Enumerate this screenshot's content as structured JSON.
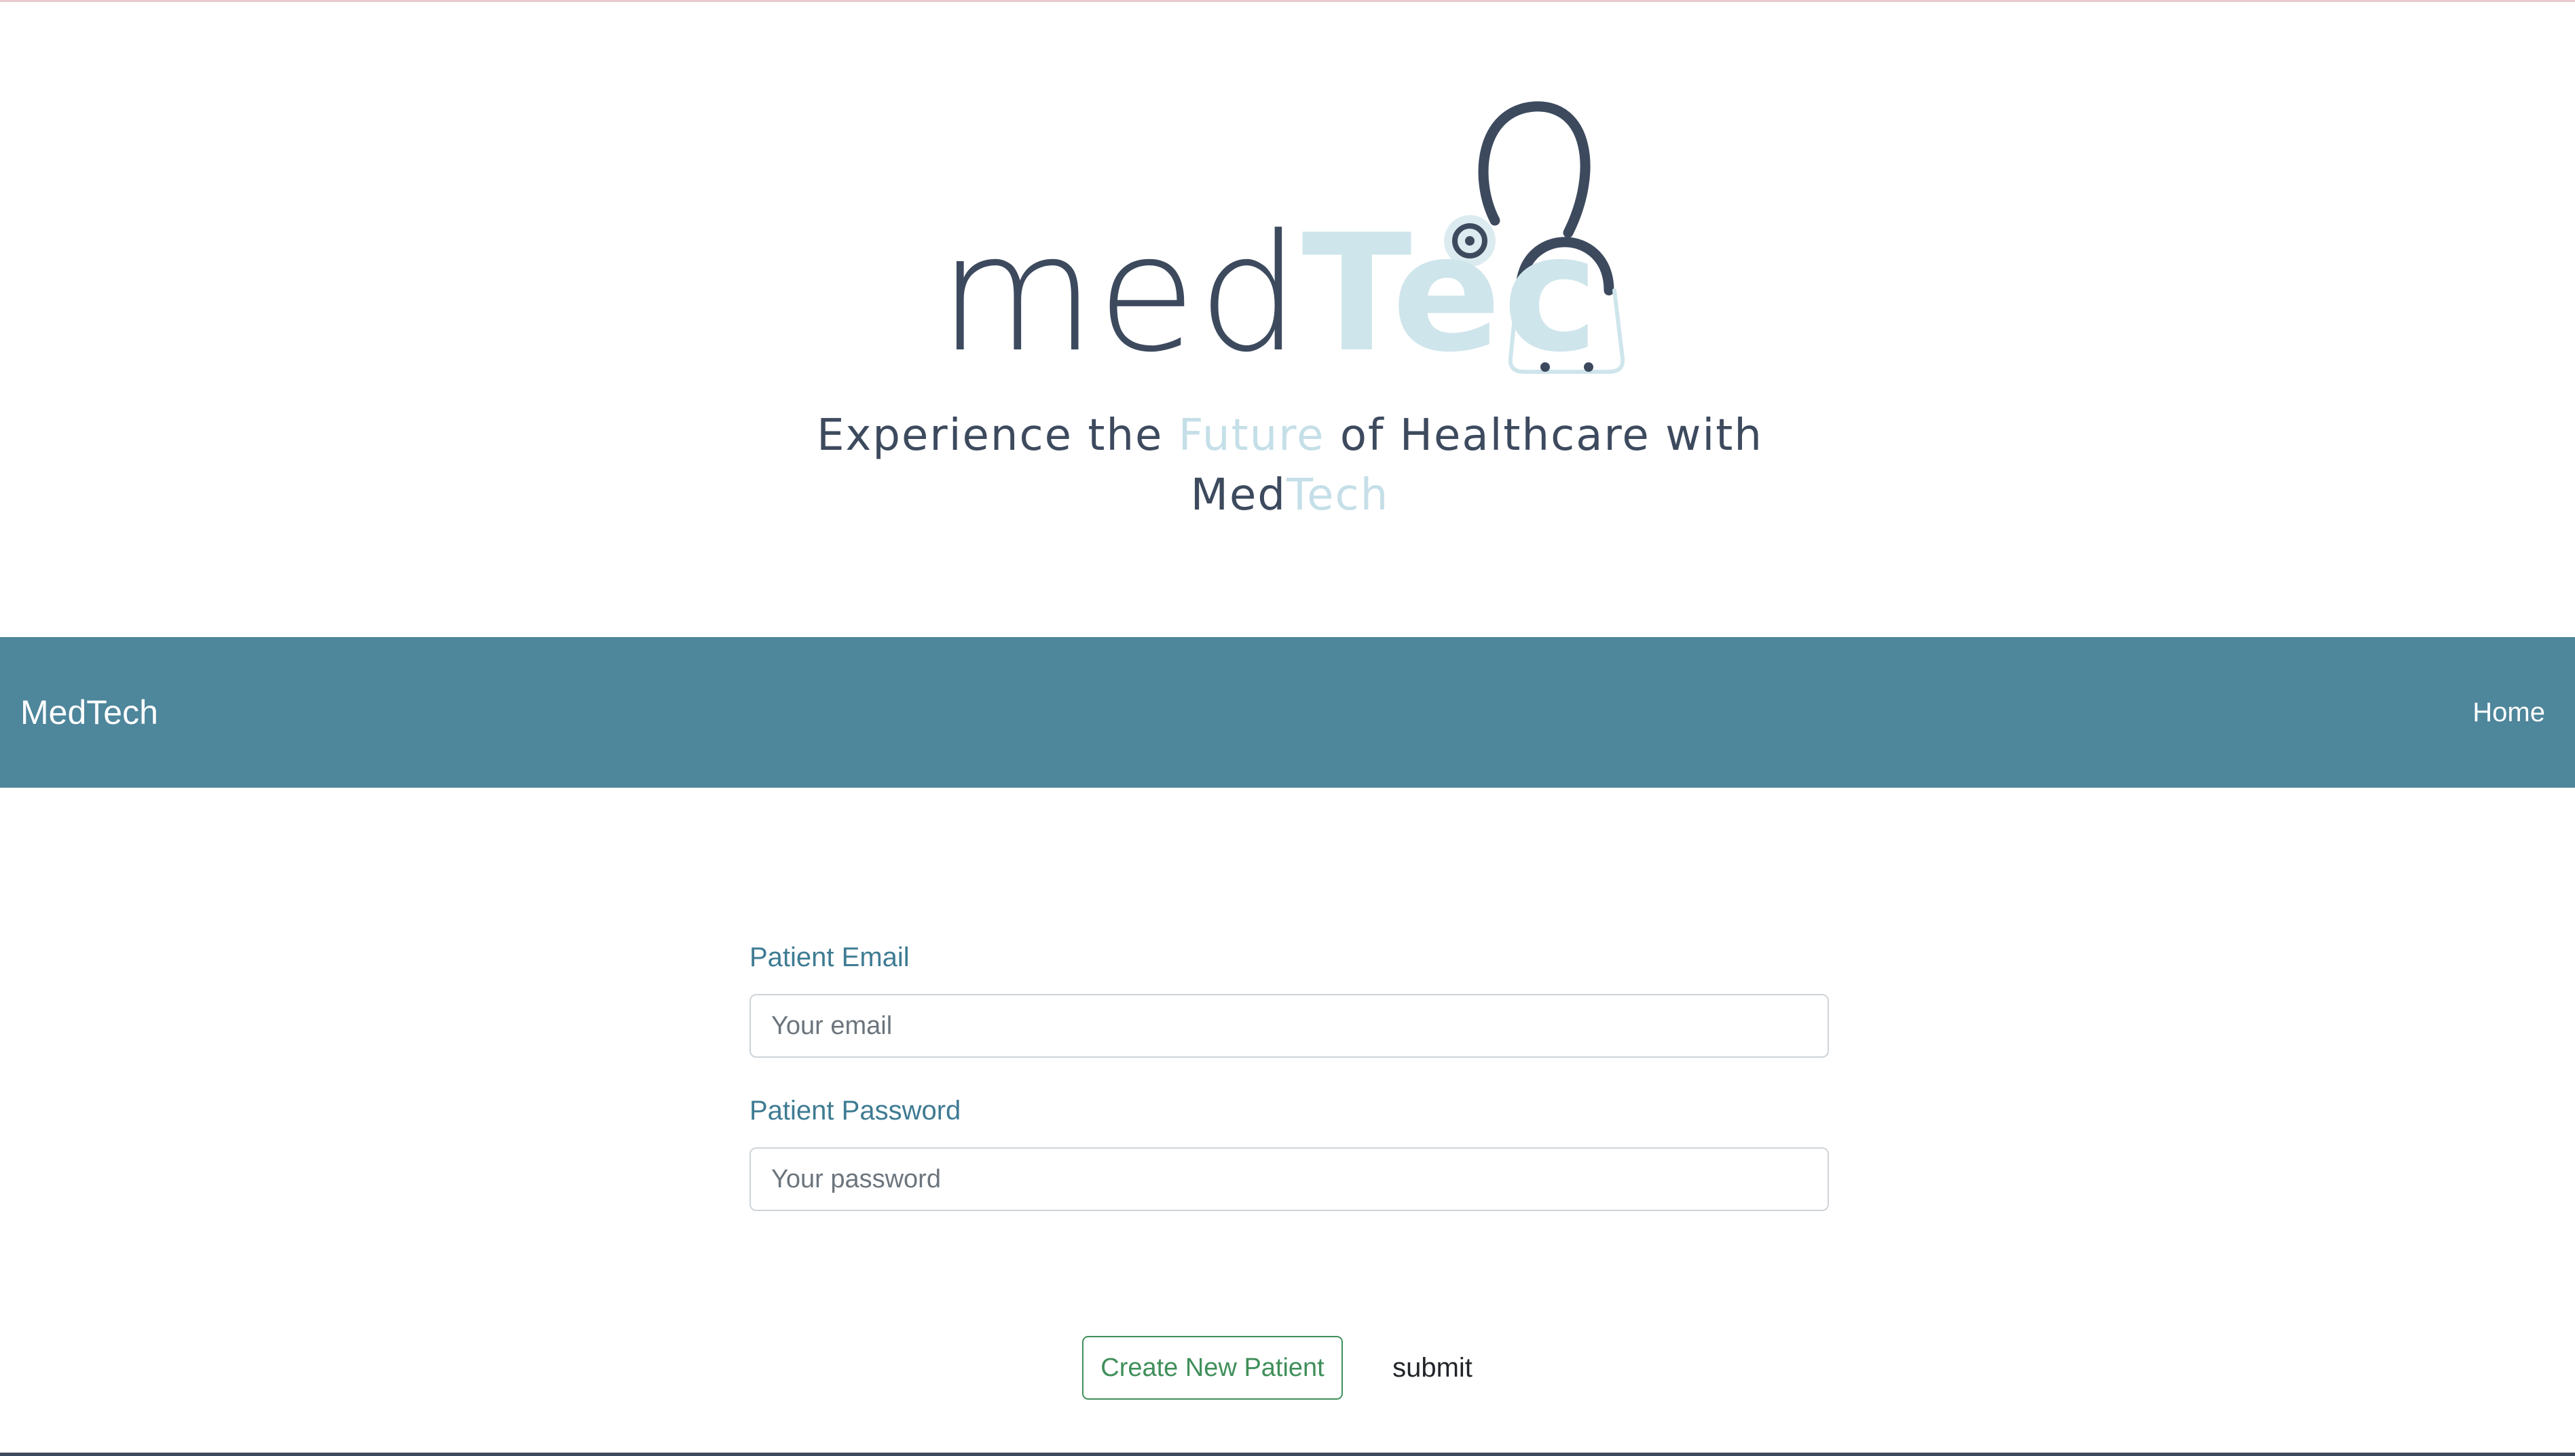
{
  "logo": {
    "wordmark_dark": "med",
    "wordmark_light": "Tec",
    "tagline_part1": "Experience the ",
    "tagline_highlight": "Future",
    "tagline_part2": " of Healthcare with",
    "tagline_brand_dark": "Med",
    "tagline_brand_light": "Tech"
  },
  "navbar": {
    "brand": "MedTech",
    "home_link": "Home"
  },
  "form": {
    "email_label": "Patient Email",
    "email_placeholder": "Your email",
    "email_value": "",
    "password_label": "Patient Password",
    "password_placeholder": "Your password",
    "password_value": "",
    "create_button": "Create New Patient",
    "submit_button": "submit"
  },
  "colors": {
    "navbar_bg": "#4e869b",
    "logo_dark": "#3d4a5e",
    "logo_light": "#cfe5ec",
    "label_color": "#3e7b93",
    "create_button_color": "#3f8f5a"
  }
}
